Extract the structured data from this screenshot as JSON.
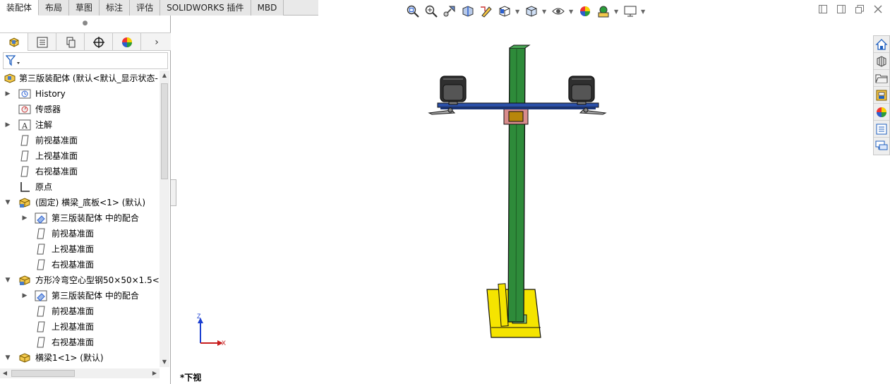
{
  "tabs": [
    "装配体",
    "布局",
    "草图",
    "标注",
    "评估",
    "SOLIDWORKS 插件",
    "MBD"
  ],
  "active_tab": "装配体",
  "manager_tabs": [
    "feature-manager",
    "property-manager",
    "configuration-manager",
    "dimxpert-manager",
    "display-manager"
  ],
  "tree": {
    "root": "第三版装配体  (默认<默认_显示状态-",
    "items": [
      {
        "label": "History"
      },
      {
        "label": "传感器"
      },
      {
        "label": "注解"
      },
      {
        "label": "前视基准面"
      },
      {
        "label": "上视基准面"
      },
      {
        "label": "右视基准面"
      },
      {
        "label": "原点"
      },
      {
        "label": "(固定) 横梁_底板<1> (默认)"
      },
      {
        "label": "第三版装配体 中的配合"
      },
      {
        "label": "前视基准面"
      },
      {
        "label": "上视基准面"
      },
      {
        "label": "右视基准面"
      },
      {
        "label": "方形冷弯空心型钢50×50×1.5<1"
      },
      {
        "label": "第三版装配体 中的配合"
      },
      {
        "label": "前视基准面"
      },
      {
        "label": "上视基准面"
      },
      {
        "label": "右视基准面"
      },
      {
        "label": "横梁1<1> (默认)"
      }
    ]
  },
  "viewport": {
    "view_name": "*下视",
    "triad": {
      "x": "X",
      "z": "Z"
    }
  },
  "colors": {
    "column": "#2e8b3a",
    "base": "#f5e400",
    "beam": "#2a4fa8",
    "camera": "#3a3a3a",
    "bracket": "#d98c8c"
  }
}
